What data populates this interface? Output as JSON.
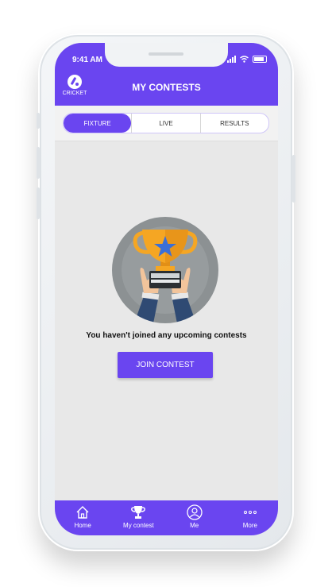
{
  "status_bar": {
    "time": "9:41 AM"
  },
  "header": {
    "sport_label": "CRICKET",
    "title": "MY CONTESTS"
  },
  "tabs": [
    {
      "label": "FIXTURE",
      "active": true
    },
    {
      "label": "LIVE",
      "active": false
    },
    {
      "label": "RESULTS",
      "active": false
    }
  ],
  "empty_state": {
    "illustration_icon": "trophy-hands-icon",
    "message": "You haven't joined any upcoming contests",
    "button_label": "JOIN CONTEST"
  },
  "bottom_nav": [
    {
      "label": "Home",
      "icon": "home-icon"
    },
    {
      "label": "My contest",
      "icon": "trophy-icon"
    },
    {
      "label": "Me",
      "icon": "user-icon"
    },
    {
      "label": "More",
      "icon": "more-icon"
    }
  ],
  "colors": {
    "accent": "#6a45f0",
    "background": "#e8e8e8",
    "trophy": "#f5a623",
    "star": "#3a6fd8"
  }
}
